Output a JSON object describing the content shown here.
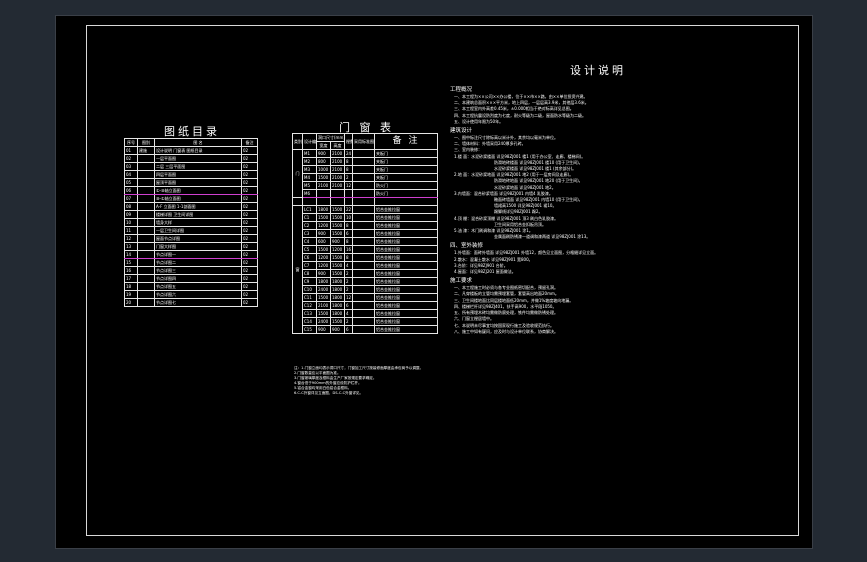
{
  "drawing_index": {
    "title": "图纸目录",
    "headers": [
      "序号",
      "图别",
      "图  名",
      "备注"
    ],
    "rows": [
      [
        "01",
        "建施",
        "设计说明 门窗表 图纸目录",
        "02"
      ],
      [
        "02",
        "",
        "一层平面图",
        "02"
      ],
      [
        "03",
        "",
        "二层 三层平面图",
        "02"
      ],
      [
        "04",
        "",
        "四层平面图",
        "02"
      ],
      [
        "05",
        "",
        "屋顶平面图",
        "02"
      ],
      [
        "06",
        "",
        "①-⑩轴立面图",
        "02"
      ],
      [
        "07",
        "",
        "⑩-①轴立面图",
        "02"
      ],
      [
        "08",
        "",
        "A-F 立面图 1-1剖面图",
        "02"
      ],
      [
        "09",
        "",
        "楼梯详图 卫生间详图",
        "02"
      ],
      [
        "10",
        "",
        "墙身大样",
        "02"
      ],
      [
        "11",
        "",
        "一层卫生间详图",
        "02"
      ],
      [
        "12",
        "",
        "屋面节点详图",
        "02"
      ],
      [
        "13",
        "",
        "门窗大样图",
        "02"
      ],
      [
        "14",
        "",
        "节点详图一",
        "02"
      ],
      [
        "15",
        "",
        "节点详图二",
        "02"
      ],
      [
        "16",
        "",
        "节点详图三",
        "02"
      ],
      [
        "17",
        "",
        "节点详图四",
        "02"
      ],
      [
        "18",
        "",
        "节点详图五",
        "02"
      ],
      [
        "19",
        "",
        "节点详图六",
        "02"
      ],
      [
        "20",
        "",
        "节点详图七",
        "02"
      ]
    ]
  },
  "door_window_schedule": {
    "title": "门  窗  表",
    "headers": [
      "类别",
      "设计编号",
      "洞口尺寸(mm)",
      "樘数",
      "采用标准图",
      "备  注"
    ],
    "sub_headers": [
      "宽度",
      "高度"
    ],
    "rows": [
      [
        "M1",
        "900",
        "2100",
        "24",
        "",
        "夹板门"
      ],
      [
        "M2",
        "800",
        "2100",
        "8",
        "",
        "夹板门"
      ],
      [
        "M3",
        "1000",
        "2100",
        "8",
        "",
        "夹板门"
      ],
      [
        "M4",
        "1500",
        "2100",
        "2",
        "",
        "夹板门"
      ],
      [
        "M5",
        "2100",
        "2100",
        "12",
        "",
        "防火门"
      ],
      [
        "M6",
        "",
        "",
        "",
        "",
        "防火门"
      ],
      [
        "",
        "",
        "",
        "",
        "",
        ""
      ],
      [
        "LC1",
        "1800",
        "1500",
        "22",
        "",
        "铝合金推拉窗"
      ],
      [
        "C1",
        "1500",
        "1500",
        "10",
        "",
        "铝合金推拉窗"
      ],
      [
        "C2",
        "1200",
        "1500",
        "8",
        "",
        "铝合金推拉窗"
      ],
      [
        "C3",
        "900",
        "1500",
        "6",
        "",
        "铝合金推拉窗"
      ],
      [
        "C4",
        "600",
        "900",
        "8",
        "",
        "铝合金推拉窗"
      ],
      [
        "C5",
        "1500",
        "1200",
        "16",
        "",
        "铝合金推拉窗"
      ],
      [
        "C6",
        "1200",
        "1500",
        "8",
        "",
        "铝合金推拉窗"
      ],
      [
        "C7",
        "1200",
        "1500",
        "4",
        "",
        "铝合金推拉窗"
      ],
      [
        "C8",
        "900",
        "1500",
        "2",
        "",
        "铝合金推拉窗"
      ],
      [
        "C9",
        "1800",
        "1800",
        "2",
        "",
        "铝合金推拉窗"
      ],
      [
        "C10",
        "2400",
        "1800",
        "2",
        "",
        "铝合金推拉窗"
      ],
      [
        "C11",
        "1500",
        "1800",
        "12",
        "",
        "铝合金推拉窗"
      ],
      [
        "C12",
        "2100",
        "1800",
        "6",
        "",
        "铝合金推拉窗"
      ],
      [
        "C13",
        "1500",
        "1800",
        "4",
        "",
        "铝合金推拉窗"
      ],
      [
        "C14",
        "2400",
        "1500",
        "2",
        "",
        "铝合金推拉窗"
      ],
      [
        "C15",
        "900",
        "900",
        "6",
        "",
        "铝合金推拉窗"
      ]
    ],
    "category_door": "门",
    "category_window": "窗",
    "notes": [
      "注：1.门窗立面均表示洞口尺寸，门窗加工尺寸按装修面厚度由承包商予以调整。",
      "2.门窗数量应以平面图为准。",
      "3.门窗玻璃厚度及框料由生产厂家按规定要求确定。",
      "4.窗台低于900mm的外窗应设防护栏杆。",
      "5.铝合金窗均采用白色铝合金框料。",
      "6.C-C外窗详见立面图，DS-C-C外窗详见。"
    ]
  },
  "design_notes": {
    "title": "设计说明",
    "sections": [
      {
        "heading": "工程概况",
        "lines": [
          {
            "indent": 1,
            "text": "一、本工程为××公司××办公楼，位于××市××路，由××单位投资兴建。"
          },
          {
            "indent": 1,
            "text": "二、本建筑总面积×××平方米，地上四层，一层层高3.9米，其他层3.6米。"
          },
          {
            "indent": 1,
            "text": "三、本工程室内外高差0.45米，±0.000相当于绝对标高详见总图。"
          },
          {
            "indent": 1,
            "text": "四、本工程抗震设防烈度为七度，耐火等级为二级，屋面防水等级为二级。"
          },
          {
            "indent": 1,
            "text": "五、设计使用年限为50年。"
          }
        ]
      },
      {
        "heading": "建筑设计",
        "lines": [
          {
            "indent": 1,
            "text": "一、图中标注尺寸除标高以米计外，其余均以毫米为单位。"
          },
          {
            "indent": 1,
            "text": "二、墙体材料：外墙采用240厚多孔砖。"
          },
          {
            "indent": 1,
            "text": "三、室内装修："
          },
          {
            "indent": 1,
            "text": "1.楼 面：水泥砂浆楼面 详见98ZJ001 楼1 (用于办公室、走廊、楼梯间)。"
          },
          {
            "indent": 2,
            "text": "防滑地砖楼面 详见98ZJ001 楼10 (用于卫生间)。"
          },
          {
            "indent": 2,
            "text": "水泥砂浆楼面 详见98ZJ001 楼1 (其余部分)。"
          },
          {
            "indent": 1,
            "text": "2.地 面：水泥砂浆地面 详见98ZJ001 地2 (用于一层房间及走廊)。"
          },
          {
            "indent": 2,
            "text": "防滑地砖地面 详见98ZJ001 地20 (用于卫生间)。"
          },
          {
            "indent": 2,
            "text": "水泥砂浆地面 详见98ZJ001 地2。"
          },
          {
            "indent": 1,
            "text": "3.内墙面：混合砂浆墙面 详见98ZJ001 内墙4 乳胶漆。"
          },
          {
            "indent": 2,
            "text": "釉面砖墙面 详见98ZJ001 内墙10 (用于卫生间)。"
          },
          {
            "indent": 2,
            "text": "墙裙高1500 详见98ZJ001 裙10。"
          },
          {
            "indent": 2,
            "text": "踢脚线详见98ZJ001 踢2。"
          },
          {
            "indent": 1,
            "text": "4.顶 棚：混合砂浆顶棚 详见98ZJ001 顶3 刷白色乳胶漆。"
          },
          {
            "indent": 2,
            "text": "卫生间采用铝合金扣板吊顶。"
          },
          {
            "indent": 1,
            "text": "5.油 漆：木门刷调和漆 详见98ZJ001 涂1。"
          },
          {
            "indent": 2,
            "text": "金属面刷防锈漆一道调和漆两道 详见98ZJ001 涂13。"
          }
        ]
      },
      {
        "heading": "四、室外装修",
        "lines": [
          {
            "indent": 1,
            "text": "1.外墙面：面砖外墙面 详见98ZJ001 外墙12，颜色见立面图，分格缝详见立面。"
          },
          {
            "indent": 1,
            "text": "2.散水：混凝土散水 详见98ZJ901 宽800。"
          },
          {
            "indent": 1,
            "text": "3.台阶：详见98ZJ901 台阶。"
          },
          {
            "indent": 1,
            "text": "4.屋面：详见98ZJ201 屋面做法。"
          }
        ]
      },
      {
        "heading": "施工要求",
        "lines": [
          {
            "indent": 1,
            "text": "一、本工程施工时必须与各专业图纸密切配合，预留孔洞。"
          },
          {
            "indent": 1,
            "text": "二、凡穿楼板的立管均需预埋套管，套管高出地面20mm。"
          },
          {
            "indent": 1,
            "text": "三、卫生间楼地面比同层楼地面低20mm，并做1%坡度坡向地漏。"
          },
          {
            "indent": 1,
            "text": "四、楼梯栏杆详见98ZJ401，扶手高900，水平段1050。"
          },
          {
            "indent": 1,
            "text": "五、所有预埋木砖均需做防腐处理，铁件均需做防锈处理。"
          },
          {
            "indent": 1,
            "text": "六、门窗立樘居墙中。"
          },
          {
            "indent": 1,
            "text": "七、本说明未尽事宜均按国家现行施工及验收规范执行。"
          },
          {
            "indent": 1,
            "text": "八、施工中如有疑问，应及时与设计单位联系，协商解决。"
          }
        ]
      }
    ]
  },
  "colors": {
    "background": "#232a33",
    "sheet": "#000000",
    "lines": "#e6e6e6",
    "highlight": "#d040d0"
  }
}
